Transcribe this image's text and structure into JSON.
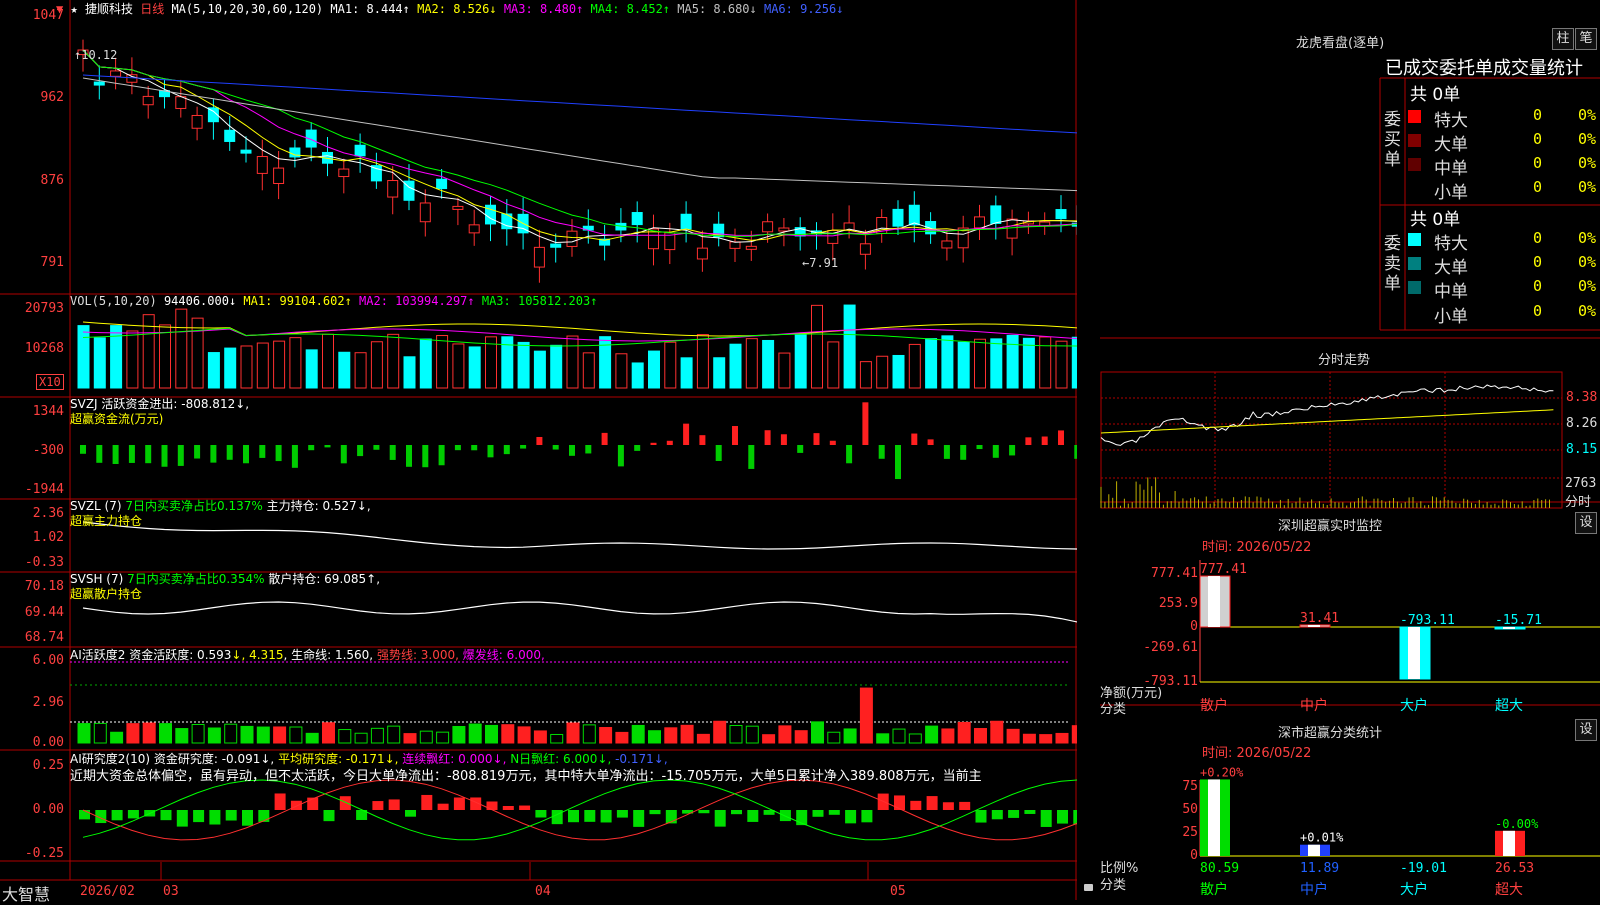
{
  "stock": {
    "header_marks": [
      "▼",
      "★"
    ],
    "name": "捷顺科技",
    "period": "日线",
    "ma_label": "MA(5,10,20,30,60,120)",
    "ma": [
      {
        "label": "MA1: 8.444↑",
        "color": "#ffffff"
      },
      {
        "label": "MA2: 8.526↓",
        "color": "#ffff00"
      },
      {
        "label": "MA3: 8.480↑",
        "color": "#ff00ff"
      },
      {
        "label": "MA4: 8.452↑",
        "color": "#00ff00"
      },
      {
        "label": "MA5: 8.680↓",
        "color": "#c0c0c0"
      },
      {
        "label": "MA6: 9.256↓",
        "color": "#0000ff"
      }
    ]
  },
  "axes": {
    "price": [
      "1047",
      "962",
      "876",
      "791"
    ],
    "vol": [
      "20793",
      "10268"
    ],
    "vol_unit": "X10",
    "svzj": [
      "1344",
      "-300",
      "-1944"
    ],
    "svzl": [
      "2.36",
      "1.02",
      "-0.33"
    ],
    "svsh": [
      "70.18",
      "69.44",
      "68.74"
    ],
    "ai1": [
      "6.00",
      "2.96",
      "0.00"
    ],
    "ai2": [
      "0.25",
      "0.00",
      "-0.25"
    ]
  },
  "annotations": {
    "high": "10.12",
    "low": "7.91"
  },
  "vol_header": {
    "label": "VOL(5,10,20)",
    "val": "94406.000↓",
    "ma1": "MA1: 99104.602↑",
    "ma2": "MA2: 103994.297↑",
    "ma3": "MA3: 105812.203↑"
  },
  "svzj_header": {
    "l1": "SVZJ  活跃资金进出: -808.812↓,",
    "l2": "超赢资金流(万元)"
  },
  "svzl_header": {
    "a": "SVZL (7) ",
    "b": "7日内买卖净占比0.137%",
    "c": " 主力持仓: 0.527↓,",
    "l2": "超赢主力持仓"
  },
  "svsh_header": {
    "a": "SVSH (7) ",
    "b": "7日内买卖净占比0.354%",
    "c": " 散户持仓: 69.085↑,",
    "l2": "超赢散户持仓"
  },
  "ai1_header": {
    "a": "AI活跃度2 资金活跃度: 0.593",
    "b": "↓, 4.315",
    "c": ", 生命线: 1.560,",
    "d": " 强势线: 3.000,",
    "e": " 爆发线: 6.000,"
  },
  "ai2_header": {
    "a": "AI研究度2(10) 资金研究度: -0.091↓,",
    "b": " 平均研究度: -0.171↓,",
    "c": " 连续飘红: 0.000↓,",
    "d": " N日飘红: 6.000↓,",
    "e": " -0.171↓,",
    "comment": "近期大资金总体偏空，虽有异动，但不太活跃，今日大单净流出：-808.819万元，其中特大单净流出：-15.705万元，大单5日累计净入389.808万元，当前主"
  },
  "timeline": {
    "brand": "大智慧",
    "labels": [
      "2026/02",
      "03",
      "04",
      "05"
    ]
  },
  "right": {
    "longhu_title": "龙虎看盘(逐单)",
    "btn_zhu": "柱",
    "btn_bi": "笔",
    "tabs_text": "已成交委托单成交量统计",
    "buy_label": "委买单",
    "sell_label": "委卖单",
    "buy_total": "共 0单",
    "sell_total": "共 0单",
    "buy_rows": [
      {
        "label": "特大",
        "count": "0",
        "pct": "0%",
        "color": "#ff0000"
      },
      {
        "label": "大单",
        "count": "0",
        "pct": "0%",
        "color": "#800000"
      },
      {
        "label": "中单",
        "count": "0",
        "pct": "0%",
        "color": "#600000"
      },
      {
        "label": "小单",
        "count": "0",
        "pct": "0%",
        "color": "#000000"
      }
    ],
    "sell_rows": [
      {
        "label": "特大",
        "count": "0",
        "pct": "0%",
        "color": "#00ffff"
      },
      {
        "label": "大单",
        "count": "0",
        "pct": "0%",
        "color": "#008080"
      },
      {
        "label": "中单",
        "count": "0",
        "pct": "0%",
        "color": "#006a6a"
      },
      {
        "label": "小单",
        "count": "0",
        "pct": "0%",
        "color": "#000000"
      }
    ],
    "intraday_title": "分时走势",
    "intraday_axis": [
      "8.38",
      "8.26",
      "8.15"
    ],
    "intraday_vol": "2763",
    "intraday_vol_unit": "分时",
    "monitor_title": "深圳超赢实时监控",
    "monitor_btn": "设",
    "monitor_time": "时间: 2026/05/22",
    "monitor_axis": [
      "777.41",
      "253.9",
      "0",
      "-269.61",
      "-793.11"
    ],
    "monitor_unit_a": "净额(万元)",
    "monitor_unit_b": "分类",
    "monitor_chart": {
      "type": "bar",
      "categories": [
        "散户",
        "中户",
        "大户",
        "超大"
      ],
      "values": [
        777.41,
        31.41,
        -793.11,
        -15.71
      ],
      "labels": [
        "777.41",
        "31.41",
        "-793.11",
        "-15.71"
      ]
    },
    "stats_title": "深市超赢分类统计",
    "stats_btn": "设",
    "stats_time": "时间: 2026/05/22",
    "stats_axis": [
      "75",
      "50",
      "25",
      "0"
    ],
    "stats_unit_a": "比例%",
    "stats_unit_b": "分类",
    "stats_chart": {
      "type": "bar",
      "categories": [
        "散户",
        "中户",
        "大户",
        "超大"
      ],
      "values": [
        80.59,
        11.89,
        -19.01,
        26.53
      ],
      "changes": [
        "+0.20%",
        "+0.01%",
        "",
        "-0.00%"
      ]
    }
  }
}
